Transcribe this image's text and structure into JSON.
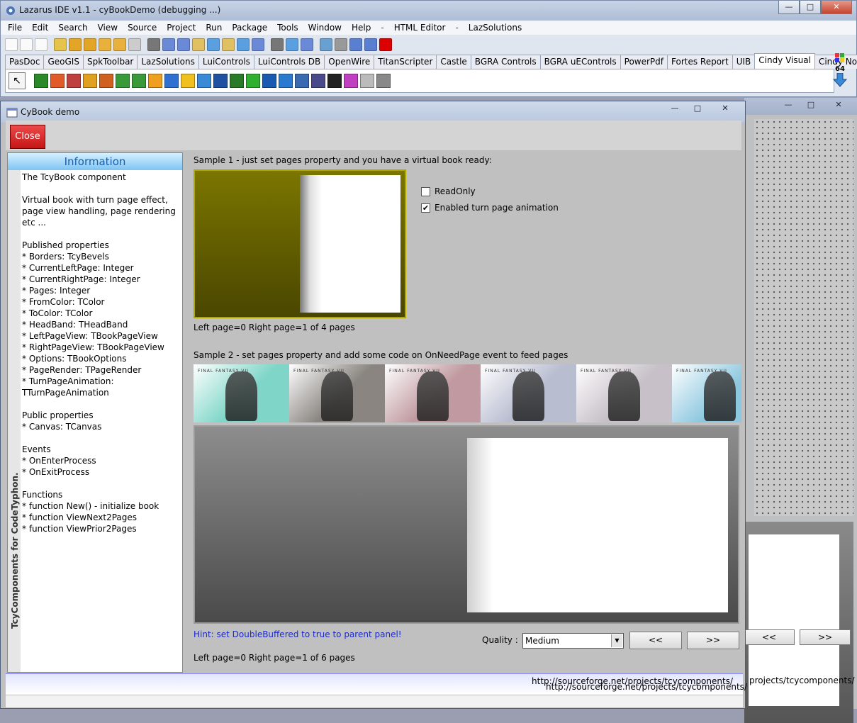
{
  "ide": {
    "title": "Lazarus IDE v1.1 - cyBookDemo (debugging ...)",
    "menu": [
      "File",
      "Edit",
      "Search",
      "View",
      "Source",
      "Project",
      "Run",
      "Package",
      "Tools",
      "Window",
      "Help",
      "-",
      "HTML Editor",
      "-",
      "LazSolutions"
    ],
    "palette_tabs": [
      "PasDoc",
      "GeoGIS",
      "SpkToolbar",
      "LazSolutions",
      "LuiControls",
      "LuiControls DB",
      "OpenWire",
      "TitanScripter",
      "Castle",
      "BGRA Controls",
      "BGRA uEControls",
      "PowerPdf",
      "Fortes Report",
      "UIB",
      "Cindy Visual",
      "Cindy Non"
    ],
    "active_tab": "Cindy Visual",
    "arch_badge": "64",
    "window_buttons": {
      "minimize": "—",
      "maximize": "□",
      "close": "✕"
    },
    "tab_scroll": {
      "left": "◀",
      "right": "▶"
    }
  },
  "toolbar_icon_colors": [
    "#fafafa",
    "#fafafa",
    "#fafafa",
    "#e6c34a",
    "#e3a526",
    "#e3a526",
    "#e8b13c",
    "#e8b13c",
    "#ccc",
    "#777",
    "#6a8ad8",
    "#6a8ad8",
    "#e0c060",
    "#5aa0e0",
    "#e0c060",
    "#5aa0e0",
    "#6a8ad8",
    "#777",
    "#5aa0e0",
    "#6a8ad8",
    "#6aa0d0",
    "#999",
    "#5a7fd0",
    "#5a7fd0",
    "#d00"
  ],
  "palette_icon_colors": [
    "#2a8a2a",
    "#e05a2a",
    "#c04040",
    "#e0a020",
    "#d06020",
    "#3a9a3a",
    "#3a9a3a",
    "#f0a020",
    "#3070d0",
    "#f0c020",
    "#3a8ad8",
    "#2050a0",
    "#2a7a2a",
    "#30b030",
    "#1a5ab0",
    "#2a7ad0",
    "#3a6ab0",
    "#4a4a8a",
    "#222",
    "#c040c0",
    "#bbb",
    "#888"
  ],
  "cybook": {
    "title": "CyBook demo",
    "close_button": "Close",
    "info_header": "Information",
    "vertical_label": "TcyComponents for CodeTyphon.",
    "info_lines": [
      "The TcyBook component",
      "",
      "Virtual book with turn page effect,",
      "page view handling, page rendering",
      "etc ...",
      "",
      "Published properties",
      "* Borders: TcyBevels",
      "* CurrentLeftPage: Integer",
      "* CurrentRightPage: Integer",
      "* Pages: Integer",
      "* FromColor: TColor",
      "* ToColor: TColor",
      "* HeadBand: THeadBand",
      "* LeftPageView: TBookPageView",
      "* RightPageView: TBookPageView",
      "* Options: TBookOptions",
      "* PageRender: TPageRender",
      "* TurnPageAnimation:",
      "TTurnPageAnimation",
      "",
      "Public properties",
      "* Canvas: TCanvas",
      "",
      "Events",
      "* OnEnterProcess",
      "* OnExitProcess",
      "",
      "Functions",
      "* function New() - initialize book",
      "* function ViewNext2Pages",
      "* function ViewPrior2Pages"
    ],
    "sample1_label": "Sample 1 - just set pages property and you have a virtual book ready:",
    "readonly_label": "ReadOnly",
    "readonly_checked": false,
    "animation_label": "Enabled turn page animation",
    "animation_checked": true,
    "sample1_status": "Left page=0  Right page=1 of 4 pages",
    "sample2_label": "Sample 2 - set pages property and add some code on OnNeedPage event to feed pages",
    "thumb_logo": "FINAL FANTASY VII",
    "thumb_colors": [
      "#7fd6c8",
      "#8a8580",
      "#c09aa0",
      "#b9bdd0",
      "#c7c0c8",
      "#8ec8e0",
      "#a9c3d9"
    ],
    "hint": "Hint: set DoubleBuffered to true to parent panel!",
    "quality_label": "Quality :",
    "quality_value": "Medium",
    "prev_button": "<<",
    "next_button": ">>",
    "sample2_status": "Left page=0  Right page=1 of 6 pages",
    "url": "http://sourceforge.net/projects/tcycomponents/",
    "url_overlap": "http://sourceforge.net/projects/tcycomponents/",
    "url_right": "projects/tcycomponents/",
    "window_buttons": {
      "minimize": "—",
      "maximize": "□",
      "close": "✕"
    }
  },
  "background_form": {
    "prev_button": "<<",
    "next_button": ">>",
    "window_buttons": {
      "minimize": "—",
      "maximize": "□",
      "close": "✕"
    }
  }
}
